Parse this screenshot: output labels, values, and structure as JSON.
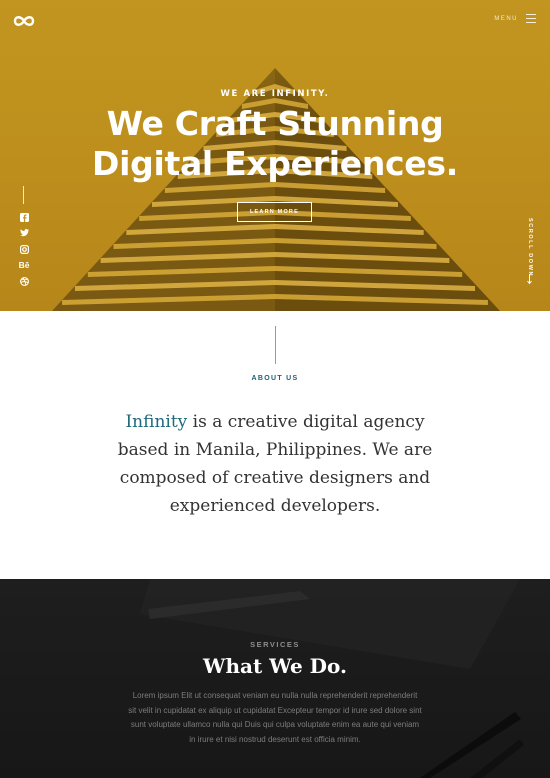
{
  "header": {
    "logo_icon": "infinity-icon",
    "menu_label": "MENU",
    "menu_icon": "hamburger-icon"
  },
  "hero": {
    "tagline": "WE ARE INFINITY.",
    "headline_line1": "We Craft Stunning",
    "headline_line2": "Digital Experiences.",
    "cta_label": "LEARN MORE",
    "scroll_label": "SCROLL DOWN",
    "social": [
      {
        "icon": "facebook-icon",
        "glyph": "f"
      },
      {
        "icon": "twitter-icon",
        "glyph": "t"
      },
      {
        "icon": "instagram-icon",
        "glyph": "◎"
      },
      {
        "icon": "behance-icon",
        "glyph": "Bē"
      },
      {
        "icon": "dribbble-icon",
        "glyph": "⊕"
      }
    ],
    "accent_color": "#c1951f"
  },
  "about": {
    "label": "ABOUT US",
    "highlight": "Infinity",
    "text_rest": " is a creative digital agency based in Manila, Philippines. We are composed of creative designers and experienced developers.",
    "accent_color": "#1d6a7d"
  },
  "services": {
    "label": "SERVICES",
    "title": "What We Do.",
    "body": "Lorem ipsum Elit ut consequat veniam eu nulla nulla reprehenderit reprehenderit sit velit in cupidatat ex aliquip ut cupidatat Excepteur tempor id irure sed dolore sint sunt voluptate ullamco nulla qui Duis qui culpa voluptate enim ea aute qui veniam in irure et nisi nostrud deserunt est officia minim."
  }
}
